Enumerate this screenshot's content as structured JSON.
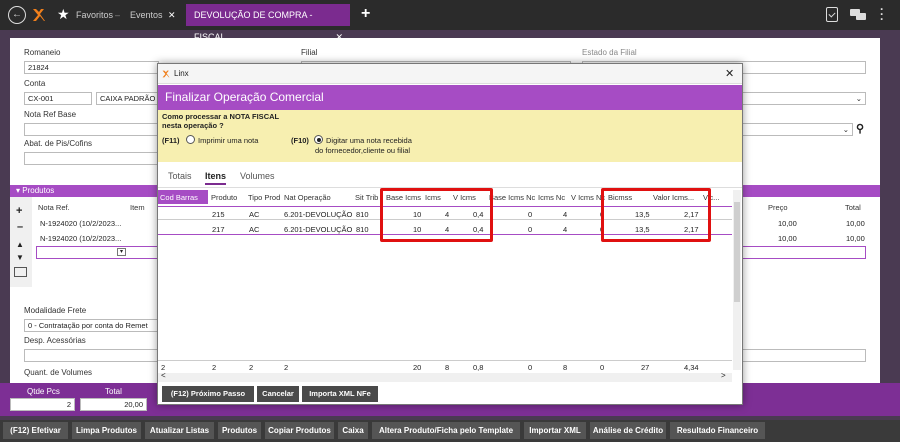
{
  "topbar": {
    "favorites": "Favoritos",
    "events_tab": "Eventos",
    "active_tab": "DEVOLUÇÃO DE COMPRA - FISCAL",
    "close_glyph": "✕",
    "plus_glyph": "+"
  },
  "form": {
    "romaneio_label": "Romaneio",
    "romaneio_value": "21824",
    "filial_label": "Filial",
    "estado_label": "Estado da Filial",
    "conta_label": "Conta",
    "conta_code": "CX-001",
    "conta_name": "CAIXA PADRÃO C",
    "nota_ref_label": "Nota Ref Base",
    "abat_label": "Abat. de Pis/Cofins",
    "produtos_header": "Produtos",
    "prod_col_nota": "Nota Ref.",
    "prod_col_item": "Item",
    "prod_col_preco": "Preço",
    "prod_col_total": "Total",
    "prod_rows": [
      {
        "nota": "N-1924020 (10/2/2023...",
        "preco": "10,00",
        "total": "10,00"
      },
      {
        "nota": "N-1924020 (10/2/2023...",
        "preco": "10,00",
        "total": "10,00"
      }
    ],
    "modalidade_label": "Modalidade Frete",
    "modalidade_value": "0 - Contratação por conta do Remet",
    "desp_label": "Desp. Acessórias",
    "quant_label": "Quant. de Volumes"
  },
  "summary": {
    "qtde_label": "Qtde Pcs",
    "qtde_value": "2",
    "total_label": "Total",
    "total_value": "20,00"
  },
  "bottom_buttons": [
    "(F12) Efetivar",
    "Limpa Produtos",
    "Atualizar Listas",
    "Produtos",
    "Copiar Produtos",
    "Caixa",
    "Altera Produto/Ficha pelo Template",
    "Importar XML",
    "Análise de Crédito",
    "Resultado Financeiro"
  ],
  "dialog": {
    "window_title": "Linx",
    "header": "Finalizar Operação Comercial",
    "question_line1": "Como processar a NOTA FISCAL",
    "question_line2": "nesta operação ?",
    "opt1_key": "(F11)",
    "opt1_label": "Imprimir uma nota",
    "opt2_key": "(F10)",
    "opt2_label_1": "Digitar uma nota recebida",
    "opt2_label_2": "do fornecedor,cliente ou filial",
    "tabs": [
      "Totais",
      "Itens",
      "Volumes"
    ],
    "columns": [
      "Cod Barras",
      "Produto",
      "Tipo Prod",
      "Nat Operação",
      "Sit Trib",
      "Base Icms",
      "Icms",
      "V Icms",
      "Base Icms Nc",
      "Icms Nc",
      "V Icms Nc",
      "Bicmss",
      "Valor Icms...",
      "V.c..."
    ],
    "rows": [
      {
        "produto": "215",
        "tipo": "AC",
        "nat": "6.201-DEVOLUÇÃO",
        "sit": "810",
        "base": "10",
        "icms": "4",
        "vicms": "0,4",
        "base_nc": "0",
        "icms_nc": "4",
        "vicms_nc": "0",
        "bicmss": "13,5",
        "valor_icms": "2,17"
      },
      {
        "produto": "217",
        "tipo": "AC",
        "nat": "6.201-DEVOLUÇÃO",
        "sit": "810",
        "base": "10",
        "icms": "4",
        "vicms": "0,4",
        "base_nc": "0",
        "icms_nc": "4",
        "vicms_nc": "0",
        "bicmss": "13,5",
        "valor_icms": "2,17"
      }
    ],
    "totals": {
      "cod": "2",
      "produto": "2",
      "tipo": "2",
      "nat": "2",
      "base": "20",
      "icms": "8",
      "vicms": "0,8",
      "base_nc": "0",
      "icms_nc": "8",
      "vicms_nc": "0",
      "bicmss": "27",
      "valor_icms": "4,34"
    },
    "buttons": [
      "(F12) Próximo Passo",
      "Cancelar",
      "Importa XML NFe"
    ]
  },
  "colors": {
    "accent": "#a64cc4",
    "dark_accent": "#7b2b8f",
    "highlight": "#e01010"
  }
}
